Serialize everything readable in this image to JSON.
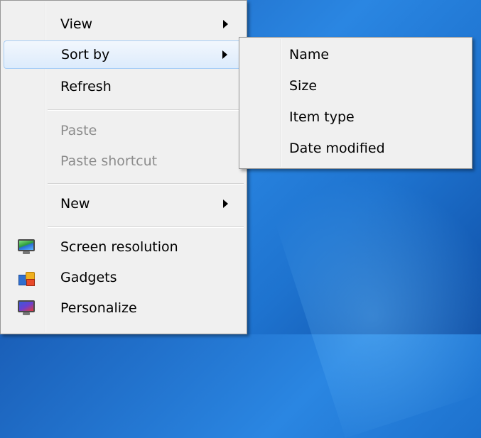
{
  "context_menu": {
    "items": [
      {
        "label": "View",
        "has_submenu": true,
        "enabled": true
      },
      {
        "label": "Sort by",
        "has_submenu": true,
        "enabled": true,
        "highlighted": true
      },
      {
        "label": "Refresh",
        "has_submenu": false,
        "enabled": true
      },
      {
        "label": "Paste",
        "has_submenu": false,
        "enabled": false
      },
      {
        "label": "Paste shortcut",
        "has_submenu": false,
        "enabled": false
      },
      {
        "label": "New",
        "has_submenu": true,
        "enabled": true
      },
      {
        "label": "Screen resolution",
        "icon": "screen-resolution-icon",
        "enabled": true
      },
      {
        "label": "Gadgets",
        "icon": "gadgets-icon",
        "enabled": true
      },
      {
        "label": "Personalize",
        "icon": "personalize-icon",
        "enabled": true
      }
    ]
  },
  "sort_submenu": {
    "items": [
      {
        "label": "Name"
      },
      {
        "label": "Size"
      },
      {
        "label": "Item type"
      },
      {
        "label": "Date modified"
      }
    ]
  },
  "colors": {
    "menu_background": "#f0f0f0",
    "highlight_border": "#a8cef6",
    "disabled_text": "#8c8c8c",
    "desktop": "#1e73cf"
  }
}
